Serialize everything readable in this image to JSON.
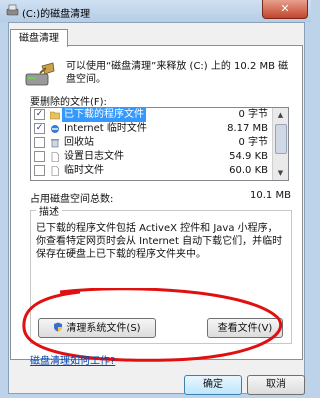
{
  "window": {
    "title": "(C:)的磁盘清理",
    "close_glyph": "✕"
  },
  "tab": {
    "label": "磁盘清理"
  },
  "intro": {
    "text": "可以使用“磁盘清理”来释放 (C:) 上的 10.2 MB 磁盘空间。"
  },
  "files": {
    "label": "要删除的文件(F):",
    "items": [
      {
        "name": "已下载的程序文件",
        "size": "0 字节",
        "checked": true,
        "selected": true,
        "icon": "folder-icon"
      },
      {
        "name": "Internet 临时文件",
        "size": "8.17 MB",
        "checked": true,
        "selected": false,
        "icon": "ie-icon"
      },
      {
        "name": "回收站",
        "size": "0 字节",
        "checked": false,
        "selected": false,
        "icon": "recycle-bin-icon"
      },
      {
        "name": "设置日志文件",
        "size": "54.9 KB",
        "checked": false,
        "selected": false,
        "icon": "file-icon"
      },
      {
        "name": "临时文件",
        "size": "60.0 KB",
        "checked": false,
        "selected": false,
        "icon": "file-icon"
      }
    ]
  },
  "total": {
    "label": "占用磁盘空间总数:",
    "value": "10.1 MB"
  },
  "description": {
    "title": "描述",
    "text": "已下载的程序文件包括 ActiveX 控件和 Java 小程序，你查看特定网页时会从 Internet 自动下载它们，并临时保存在硬盘上已下载的程序文件夹中。"
  },
  "buttons": {
    "clean_system": "清理系统文件(S)",
    "view_files": "查看文件(V)",
    "ok": "确定",
    "cancel": "取消"
  },
  "link": {
    "text": "磁盘清理如何工作?"
  },
  "colors": {
    "selection": "#3399ff",
    "annotation_circle": "#e01010",
    "link": "#0645ad"
  }
}
